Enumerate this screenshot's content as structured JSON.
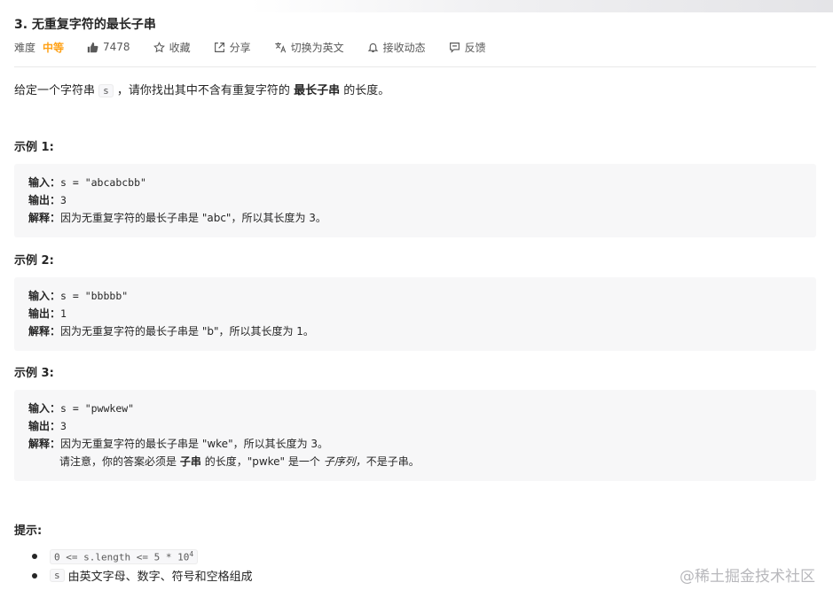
{
  "problem": {
    "title": "3. 无重复字符的最长子串",
    "difficulty_label": "难度",
    "difficulty_value": "中等",
    "likes": "7478",
    "actions": {
      "favorite": "收藏",
      "share": "分享",
      "switch_lang": "切换为英文",
      "notify": "接收动态",
      "feedback": "反馈"
    },
    "description": {
      "prefix": "给定一个字符串",
      "code": "s",
      "middle": "，请你找出其中不含有重复字符的",
      "bold": "最长子串",
      "suffix": "的长度。"
    }
  },
  "examples": [
    {
      "title": "示例 1:",
      "input_label": "输入：",
      "input": "s = \"abcabcbb\"",
      "output_label": "输出：",
      "output": "3",
      "explain_label": "解释：",
      "explain": "因为无重复字符的最长子串是 \"abc\"，所以其长度为 3。"
    },
    {
      "title": "示例 2:",
      "input_label": "输入：",
      "input": "s = \"bbbbb\"",
      "output_label": "输出：",
      "output": "1",
      "explain_label": "解释：",
      "explain": "因为无重复字符的最长子串是 \"b\"，所以其长度为 1。"
    },
    {
      "title": "示例 3:",
      "input_label": "输入：",
      "input": "s = \"pwwkew\"",
      "output_label": "输出：",
      "output": "3",
      "explain_label": "解释：",
      "explain": "因为无重复字符的最长子串是 \"wke\"，所以其长度为 3。",
      "note_prefix": "请注意，你的答案必须是",
      "note_bold": "子串",
      "note_middle": "的长度，\"pwke\" 是一个",
      "note_italic": "子序列，",
      "note_suffix": "不是子串。"
    }
  ],
  "hints": {
    "title": "提示:",
    "items": [
      {
        "code": "0 <= s.length <= 5 * 10",
        "sup": "4"
      },
      {
        "code": "s",
        "text": "由英文字母、数字、符号和空格组成"
      }
    ]
  },
  "watermark": "@稀土掘金技术社区"
}
